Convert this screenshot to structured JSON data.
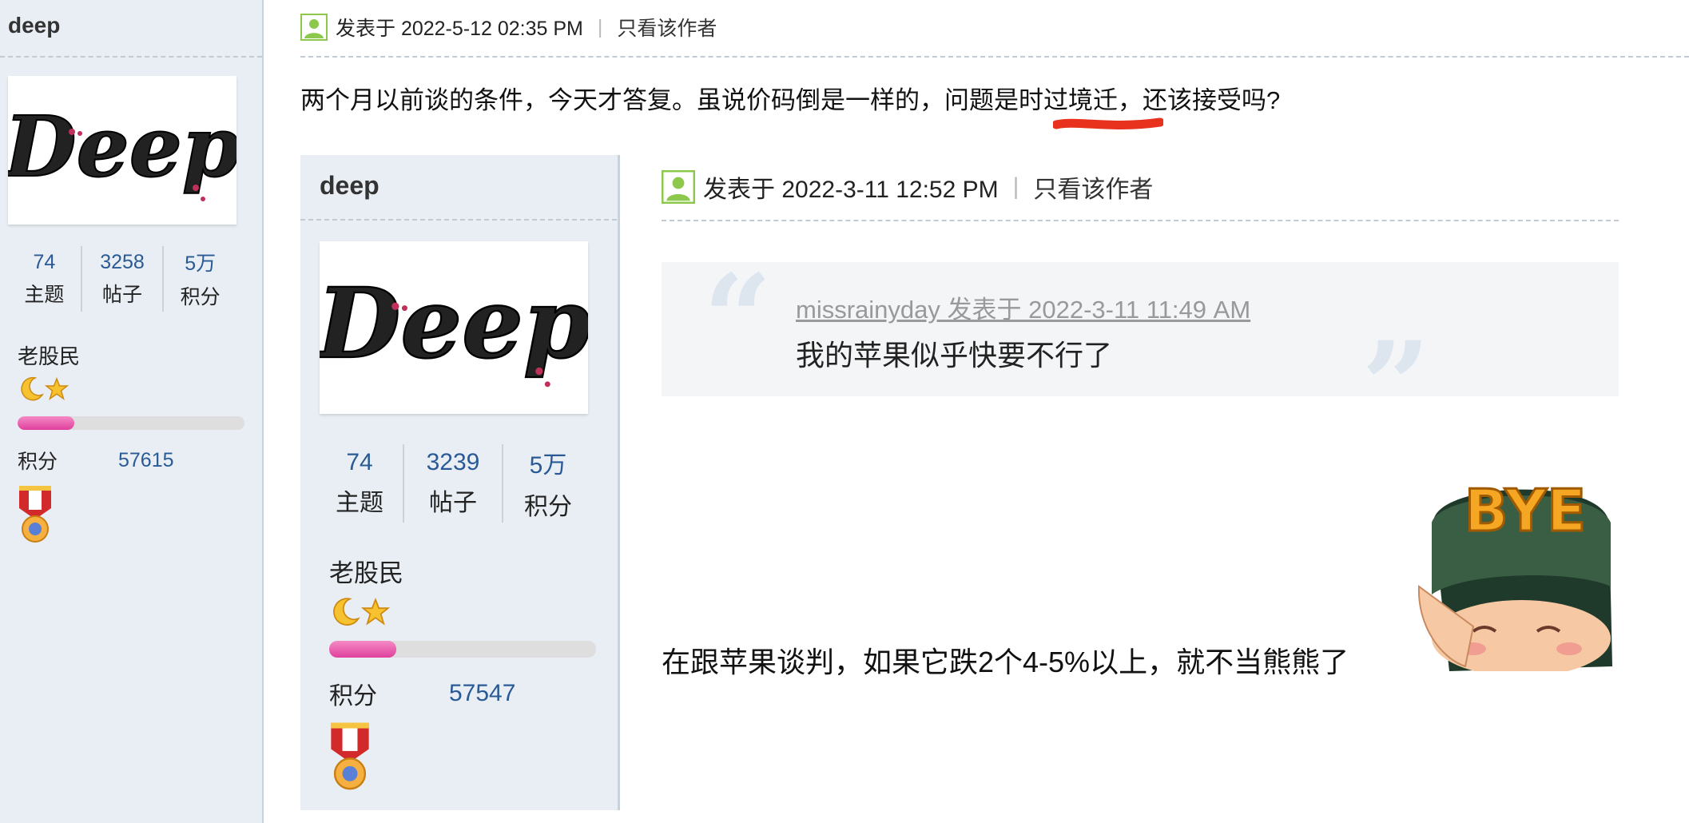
{
  "sidebar": {
    "username": "deep",
    "avatar_text": "Deep",
    "stats": [
      {
        "num": "74",
        "label": "主题"
      },
      {
        "num": "3258",
        "label": "帖子"
      },
      {
        "num": "5万",
        "label": "积分"
      }
    ],
    "rank": "老股民",
    "progress_fraction": 0.25,
    "credit_label": "积分",
    "credit_value": "57615"
  },
  "post": {
    "posted_at": "发表于 2022-5-12 02:35 PM",
    "pipe": "|",
    "only_author": "只看该作者",
    "body_before": "两个月以前谈的条件，今天才答复。虽说价码倒是一样的，问题是",
    "body_highlight": "时过境迁",
    "body_after": "，还该接受吗?"
  },
  "embedded": {
    "sidebar": {
      "username": "deep",
      "avatar_text": "Deep",
      "stats": [
        {
          "num": "74",
          "label": "主题"
        },
        {
          "num": "3239",
          "label": "帖子"
        },
        {
          "num": "5万",
          "label": "积分"
        }
      ],
      "rank": "老股民",
      "progress_fraction": 0.25,
      "credit_label": "积分",
      "credit_value": "57547"
    },
    "post": {
      "posted_at": "发表于 2022-3-11 12:52 PM",
      "pipe": "|",
      "only_author": "只看该作者",
      "quote_meta": "missrainyday 发表于 2022-3-11 11:49 AM",
      "quote_text": "我的苹果似乎快要不行了",
      "reply_text": "在跟苹果谈判，如果它跌2个4-5%以上，就不当熊熊了",
      "sticker_text": "BYE"
    }
  },
  "colors": {
    "link_blue": "#2a5a95",
    "side_bg": "#e8eef3",
    "progress_pink": "#e0409c",
    "annotation_red": "#e8321e"
  },
  "icons": [
    "user-icon",
    "moon-icon",
    "star-icon",
    "medal-icon",
    "quote-open-icon",
    "quote-close-icon",
    "bye-sticker-icon"
  ]
}
